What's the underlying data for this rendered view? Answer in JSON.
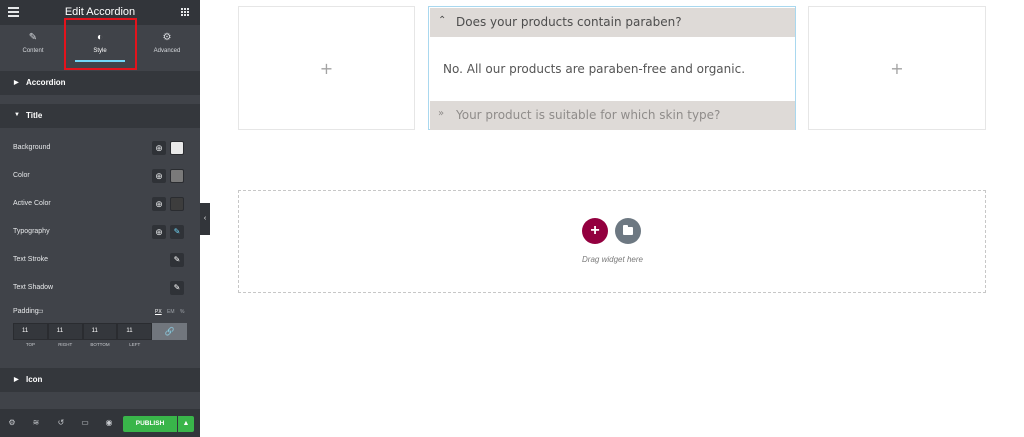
{
  "panel": {
    "title": "Edit Accordion",
    "tabs": [
      {
        "label": "Content",
        "icon": "pencil-icon"
      },
      {
        "label": "Style",
        "icon": "half-circle-icon"
      },
      {
        "label": "Advanced",
        "icon": "gear-icon"
      }
    ],
    "active_tab": "Style",
    "sections": {
      "accordion": "Accordion",
      "title": "Title",
      "icon": "Icon"
    },
    "rows": {
      "background": "Background",
      "color": "Color",
      "active_color": "Active Color",
      "typography": "Typography",
      "text_stroke": "Text Stroke",
      "text_shadow": "Text Shadow",
      "padding": "Padding"
    },
    "swatches": {
      "background": "#e9e9e9",
      "color": "#7a7a7a",
      "active_color": "#3d3d3d"
    },
    "units": {
      "px": "PX",
      "em": "EM",
      "percent": "%"
    },
    "padding_values": [
      "11",
      "11",
      "11",
      "11"
    ],
    "padding_labels": [
      "TOP",
      "RIGHT",
      "BOTTOM",
      "LEFT"
    ],
    "publish_label": "PUBLISH"
  },
  "canvas": {
    "accordion": {
      "items": [
        {
          "title": "Does your products contain paraben?",
          "icon": "chevron-up-icon"
        },
        {
          "title": "Your product is suitable for which skin type?",
          "icon": "double-chevron-down-icon"
        }
      ],
      "open_answer": "No. All our products are paraben-free and organic."
    },
    "empty_column_plus": "+",
    "add_symbol": "+",
    "drag_text": "Drag widget here"
  },
  "colors": {
    "publish": "#39b54a",
    "add_button": "#93003f",
    "active_tab_underline": "#71d7f7",
    "highlight_box": "#e3131c"
  }
}
